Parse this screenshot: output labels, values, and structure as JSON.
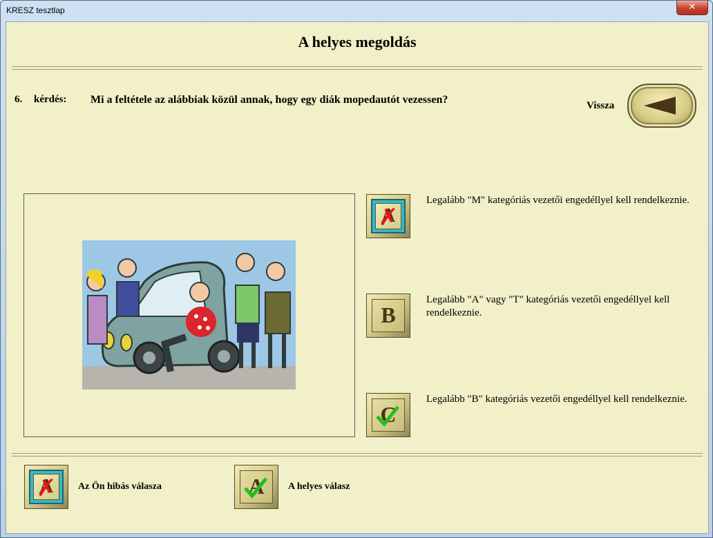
{
  "window": {
    "title": "KRESZ tesztlap",
    "close_glyph": "✕"
  },
  "header": {
    "title": "A helyes megoldás"
  },
  "question": {
    "number": "6.",
    "label": "kérdés:",
    "text": "Mi a feltétele az alábbiak közül annak, hogy egy diák mopedautót vezessen?"
  },
  "back": {
    "label": "Vissza",
    "icon": "left-arrow-icon"
  },
  "answers": [
    {
      "letter": "A",
      "text": "Legalább \"M\" kategóriás vezetői engedéllyel kell rendelkeznie.",
      "state": "wrong"
    },
    {
      "letter": "B",
      "text": "Legalább \"A\" vagy \"T\" kategóriás vezetői engedéllyel kell rendelkeznie.",
      "state": "none"
    },
    {
      "letter": "C",
      "text": "Legalább \"B\" kategóriás vezetői engedéllyel kell rendelkeznie.",
      "state": "correct"
    }
  ],
  "legend": {
    "wrong": {
      "label": "Az Ön hibás válasza",
      "letter": "A"
    },
    "correct": {
      "label": "A helyes válasz",
      "letter": "A"
    }
  },
  "colors": {
    "background": "#f2f0c8",
    "wrong_mark": "#e8141b",
    "correct_mark": "#1fbf1f",
    "wrong_frame": "#35b9c9"
  }
}
